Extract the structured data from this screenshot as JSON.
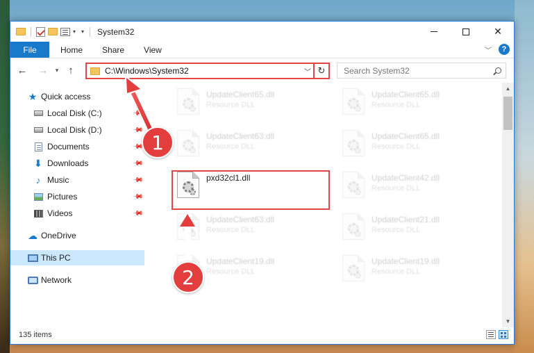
{
  "window": {
    "title": "System32",
    "controls": {
      "minimize": "—",
      "maximize": "□",
      "close": "✕"
    }
  },
  "ribbon": {
    "tabs": [
      "File",
      "Home",
      "Share",
      "View"
    ],
    "help": "?"
  },
  "nav": {
    "address": "C:\\Windows\\System32",
    "search_placeholder": "Search System32"
  },
  "sidebar": {
    "items": [
      {
        "label": "Quick access",
        "icon": "star-icon"
      },
      {
        "label": "Local Disk (C:)",
        "icon": "drive-icon",
        "pinned": true
      },
      {
        "label": "Local Disk (D:)",
        "icon": "drive-icon",
        "pinned": true
      },
      {
        "label": "Documents",
        "icon": "documents-icon",
        "pinned": true
      },
      {
        "label": "Downloads",
        "icon": "downloads-icon",
        "pinned": true
      },
      {
        "label": "Music",
        "icon": "music-icon",
        "pinned": true
      },
      {
        "label": "Pictures",
        "icon": "pictures-icon",
        "pinned": true
      },
      {
        "label": "Videos",
        "icon": "videos-icon",
        "pinned": true
      },
      {
        "label": "OneDrive",
        "icon": "cloud-icon"
      },
      {
        "label": "This PC",
        "icon": "computer-icon",
        "selected": true
      },
      {
        "label": "Network",
        "icon": "network-icon"
      }
    ]
  },
  "files": [
    {
      "name": "UpdateClient65.dll",
      "type": "Resource DLL",
      "faded": true
    },
    {
      "name": "UpdateClient65.dll",
      "type": "Resource DLL",
      "faded": true
    },
    {
      "name": "UpdateClient63.dll",
      "type": "Resource DLL",
      "faded": true
    },
    {
      "name": "UpdateClient65.dll",
      "type": "Resource DLL",
      "faded": true
    },
    {
      "name": "pxd32cl1.dll",
      "type": "",
      "faded": false
    },
    {
      "name": "UpdateClient42.dll",
      "type": "Resource DLL",
      "faded": true
    },
    {
      "name": "UpdateClient63.dll",
      "type": "Resource DLL",
      "faded": true
    },
    {
      "name": "UpdateClient21.dll",
      "type": "Resource DLL",
      "faded": true
    },
    {
      "name": "UpdateClient19.dll",
      "type": "Resource DLL",
      "faded": true
    },
    {
      "name": "UpdateClient19.dll",
      "type": "Resource DLL",
      "faded": true
    }
  ],
  "status": {
    "items": "135 items"
  },
  "annotations": {
    "step1": "1",
    "step2": "2"
  },
  "colors": {
    "accent": "#1979ca",
    "annotation": "#e43d3d",
    "selected": "#cce8ff"
  }
}
